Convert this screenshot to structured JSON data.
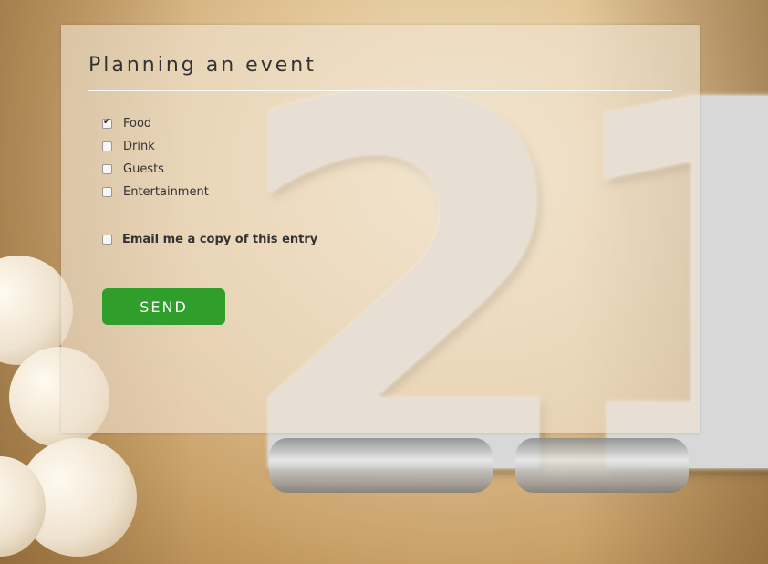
{
  "form": {
    "title": "Planning an event",
    "options": [
      {
        "label": "Food",
        "checked": true
      },
      {
        "label": "Drink",
        "checked": false
      },
      {
        "label": "Guests",
        "checked": false
      },
      {
        "label": "Entertainment",
        "checked": false
      }
    ],
    "email_copy": {
      "label": "Email me a copy of this entry",
      "checked": false
    },
    "submit_label": "SEND"
  },
  "background": {
    "balloon_digits": "21",
    "accent_color": "#2f9e2b"
  }
}
